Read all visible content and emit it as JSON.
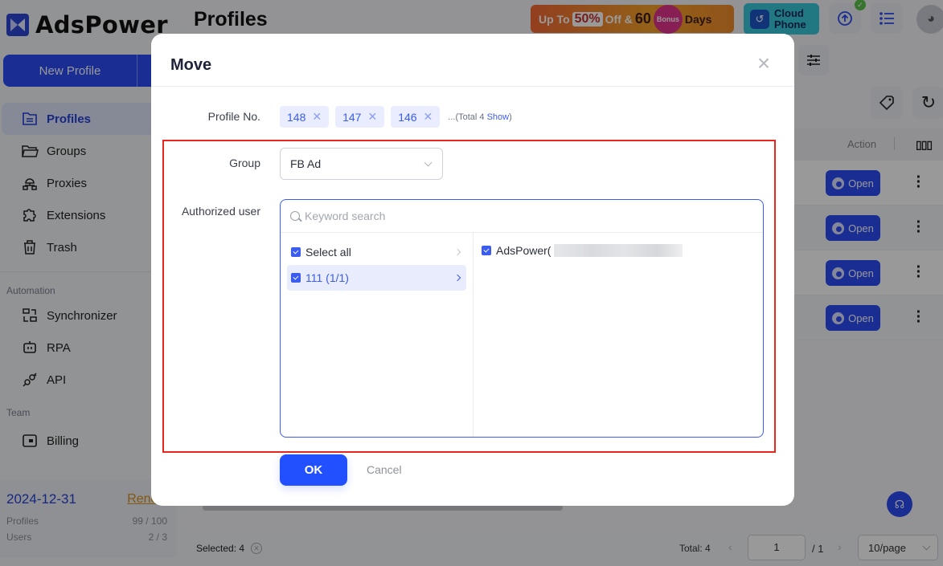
{
  "app": {
    "brand": "AdsPower",
    "page_title": "Profiles",
    "new_profile_label": "New Profile"
  },
  "sidebar": {
    "items": [
      {
        "label": "Profiles",
        "icon": "profiles-icon",
        "active": true
      },
      {
        "label": "Groups",
        "icon": "folder-icon"
      },
      {
        "label": "Proxies",
        "icon": "proxy-icon"
      },
      {
        "label": "Extensions",
        "icon": "puzzle-icon"
      },
      {
        "label": "Trash",
        "icon": "trash-icon"
      }
    ],
    "automation_label": "Automation",
    "automation_items": [
      {
        "label": "Synchronizer",
        "icon": "synchronizer-icon"
      },
      {
        "label": "RPA",
        "icon": "robot-icon"
      },
      {
        "label": "API",
        "icon": "plug-icon"
      }
    ],
    "team_label": "Team",
    "team_items": [
      {
        "label": "Billing",
        "icon": "wallet-icon"
      }
    ],
    "plan": {
      "expiry_date": "2024-12-31",
      "renew_label": "Renew",
      "profiles_label": "Profiles",
      "profiles_value": "99 / 100",
      "users_label": "Users",
      "users_value": "2 / 3"
    }
  },
  "header": {
    "promo": {
      "up_to": "Up To",
      "percent": "50%",
      "off": "Off &",
      "days_num": "60",
      "bonus": "Bonus",
      "days": "Days"
    },
    "cloud_phone": {
      "line1": "Cloud",
      "line2": "Phone"
    }
  },
  "table": {
    "action_header": "Action",
    "open_label": "Open",
    "rows": 4
  },
  "footer": {
    "selected_text": "Selected: 4",
    "total_text": "Total: 4",
    "current_page": "1",
    "page_of": "/ 1",
    "page_size": "10/page"
  },
  "modal": {
    "title": "Move",
    "profile_no_label": "Profile No.",
    "profile_tags": [
      "148",
      "147",
      "146"
    ],
    "tags_more_prefix": "...(Total 4 ",
    "tags_more_link": "Show",
    "tags_more_suffix": ")",
    "group_label": "Group",
    "group_value": "FB Ad",
    "authorized_user_label": "Authorized user",
    "search_placeholder": "Keyword search",
    "left_list": [
      {
        "label": "Select all",
        "checked": true,
        "selected": false
      },
      {
        "label": "111 (1/1)",
        "checked": true,
        "selected": true
      }
    ],
    "right_list": [
      {
        "label": "AdsPower(",
        "checked": true,
        "redacted": true
      }
    ],
    "ok_label": "OK",
    "cancel_label": "Cancel"
  },
  "colors": {
    "accent": "#2350ff",
    "highlight_border": "#e8261e",
    "renew": "#d9911f"
  }
}
